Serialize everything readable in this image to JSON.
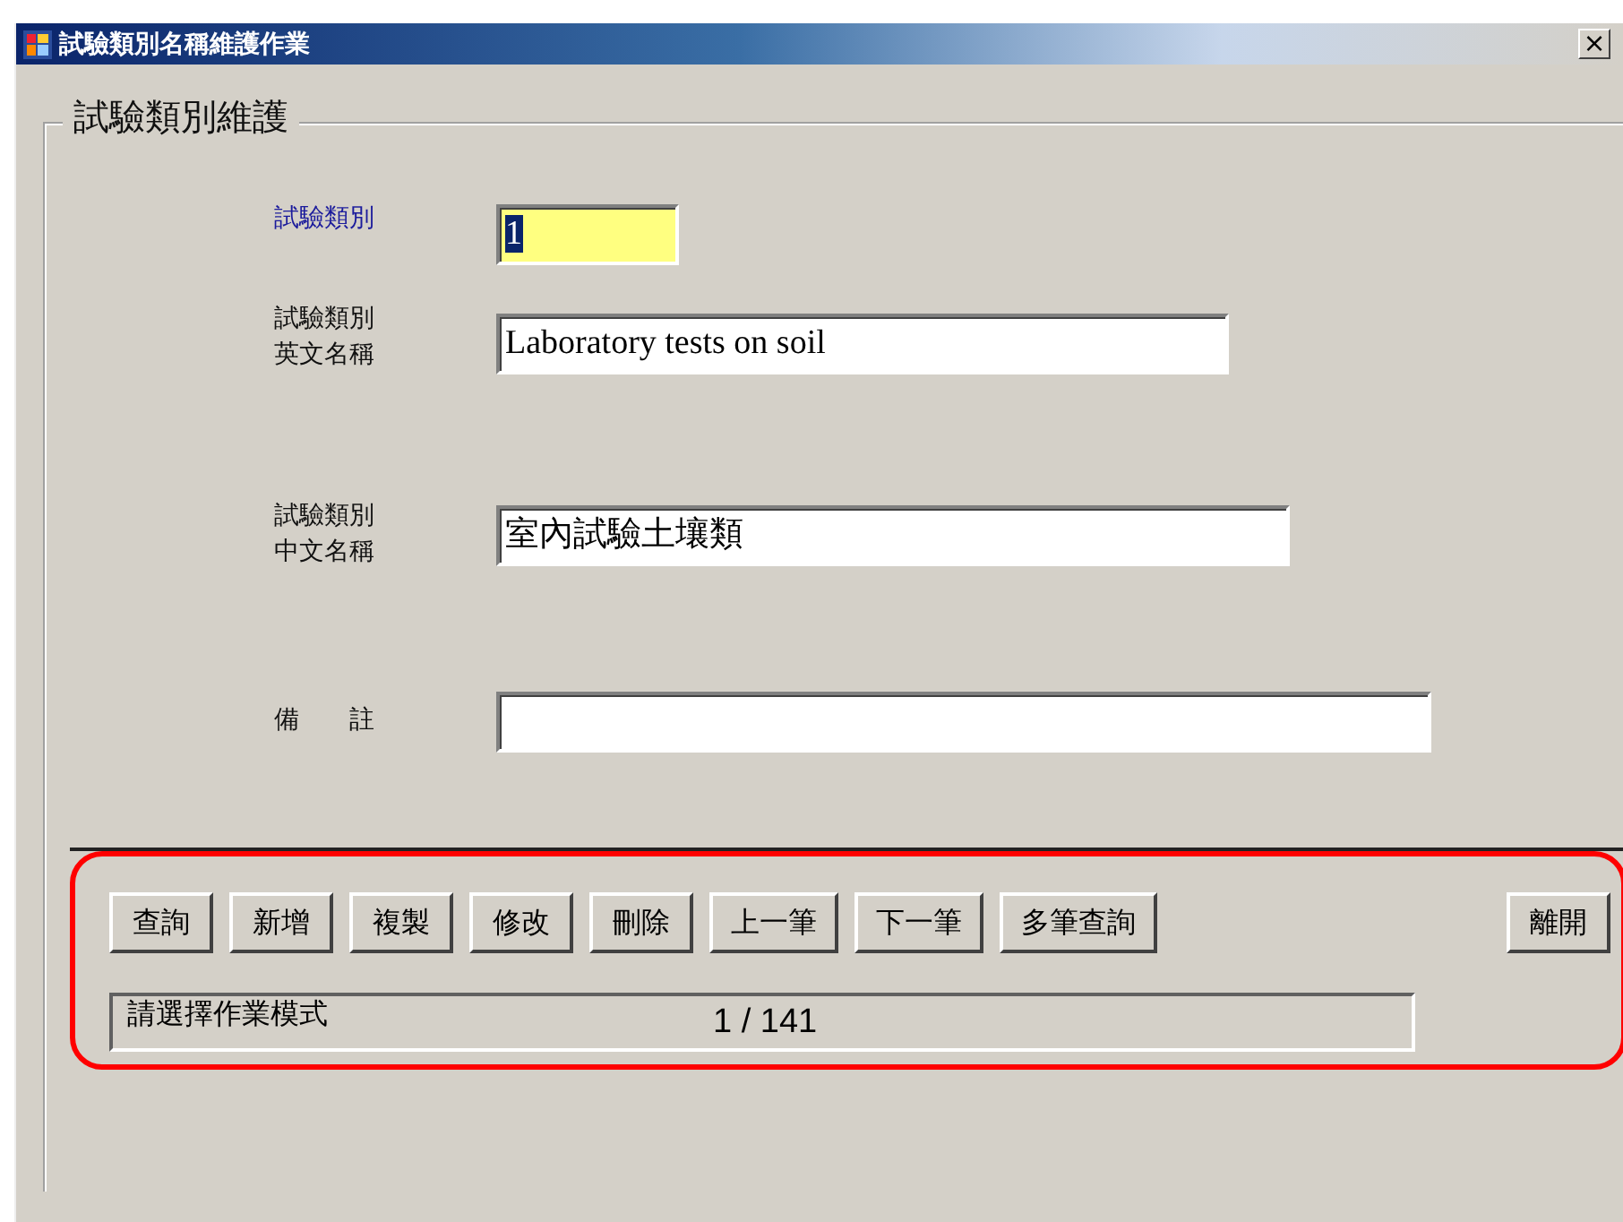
{
  "window": {
    "title": "試驗類別名稱維護作業",
    "close": "×"
  },
  "group": {
    "title": "試驗類別維護"
  },
  "fields": [
    {
      "label": "試驗類別",
      "value": "1",
      "focused": true
    },
    {
      "label": "試驗類別英文名稱",
      "value": "Laboratory tests on soil",
      "focused": false
    },
    {
      "label": "試驗類別中文名稱",
      "value": "室內試驗土壤類",
      "focused": false
    },
    {
      "label": "備　　註",
      "focused": false
    }
  ],
  "buttons": [
    {
      "label": "查詢"
    },
    {
      "label": "新增"
    },
    {
      "label": "複製"
    },
    {
      "label": "修改"
    },
    {
      "label": "刪除"
    },
    {
      "label": "上一筆"
    },
    {
      "label": "下一筆"
    },
    {
      "label": "多筆查詢"
    }
  ],
  "exit_button": {
    "label": "離開"
  },
  "status_bar": {
    "message": "請選擇作業模式",
    "record": "1 / 141"
  }
}
